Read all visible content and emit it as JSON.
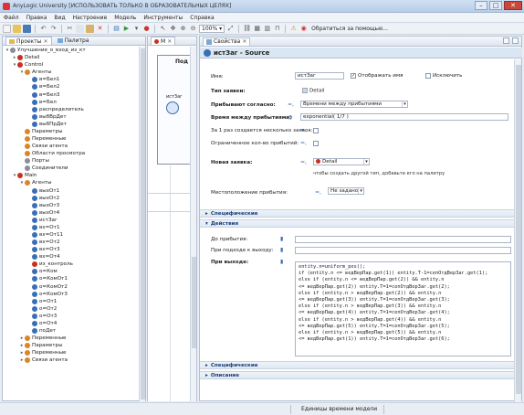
{
  "window": {
    "title": "AnyLogic University [ИСПОЛЬЗОВАТЬ ТОЛЬКО В ОБРАЗОВАТЕЛЬНЫХ ЦЕЛЯХ]",
    "min": "–",
    "max": "□",
    "close": "✕"
  },
  "menu": [
    "Файл",
    "Правка",
    "Вид",
    "Настроение",
    "Модель",
    "Инструменты",
    "Справка"
  ],
  "toolbar": {
    "zoom": "100%",
    "extra_label": "Обратиться за помощью..."
  },
  "left_panel": {
    "tabs": [
      {
        "label": "Проекты",
        "close": "✕"
      },
      {
        "label": "Палитра"
      }
    ],
    "tree": [
      {
        "indent": 0,
        "twisty": "▾",
        "icon": "gray",
        "label": "Улучшение_о_вход_из_кт"
      },
      {
        "indent": 1,
        "twisty": "▸",
        "icon": "red",
        "label": "Detail"
      },
      {
        "indent": 1,
        "twisty": "▾",
        "icon": "red",
        "label": "Control"
      },
      {
        "indent": 2,
        "twisty": "▾",
        "icon": "orange",
        "label": "Агенты"
      },
      {
        "indent": 3,
        "twisty": "",
        "icon": "blue",
        "label": "в=Бел1"
      },
      {
        "indent": 3,
        "twisty": "",
        "icon": "blue",
        "label": "в=Бел2"
      },
      {
        "indent": 3,
        "twisty": "",
        "icon": "blue",
        "label": "в=Бел3"
      },
      {
        "indent": 3,
        "twisty": "",
        "icon": "blue",
        "label": "в=Бел"
      },
      {
        "indent": 3,
        "twisty": "",
        "icon": "blue",
        "label": "распределитель"
      },
      {
        "indent": 3,
        "twisty": "",
        "icon": "blue",
        "label": "выбВрДет"
      },
      {
        "indent": 3,
        "twisty": "",
        "icon": "blue",
        "label": "выбПрДет"
      },
      {
        "indent": 2,
        "twisty": "",
        "icon": "orange",
        "label": "Параметры"
      },
      {
        "indent": 2,
        "twisty": "",
        "icon": "orange",
        "label": "Переменные"
      },
      {
        "indent": 2,
        "twisty": "",
        "icon": "orange",
        "label": "Связи агента"
      },
      {
        "indent": 2,
        "twisty": "",
        "icon": "orange",
        "label": "Области просмотра"
      },
      {
        "indent": 2,
        "twisty": "",
        "icon": "gray",
        "label": "Порты"
      },
      {
        "indent": 2,
        "twisty": "",
        "icon": "gray",
        "label": "Соединители"
      },
      {
        "indent": 1,
        "twisty": "▾",
        "icon": "red",
        "label": "Main"
      },
      {
        "indent": 2,
        "twisty": "▾",
        "icon": "orange",
        "label": "Агенты"
      },
      {
        "indent": 3,
        "twisty": "",
        "icon": "blue",
        "label": "выхОт1"
      },
      {
        "indent": 3,
        "twisty": "",
        "icon": "blue",
        "label": "выхОт2"
      },
      {
        "indent": 3,
        "twisty": "",
        "icon": "blue",
        "label": "выхОт3"
      },
      {
        "indent": 3,
        "twisty": "",
        "icon": "blue",
        "label": "выхОт4"
      },
      {
        "indent": 3,
        "twisty": "",
        "icon": "blue",
        "label": "истЗаг"
      },
      {
        "indent": 3,
        "twisty": "",
        "icon": "blue",
        "label": "вх=От1"
      },
      {
        "indent": 3,
        "twisty": "",
        "icon": "blue",
        "label": "вх=От11"
      },
      {
        "indent": 3,
        "twisty": "",
        "icon": "blue",
        "label": "вх=От2"
      },
      {
        "indent": 3,
        "twisty": "",
        "icon": "blue",
        "label": "вх=От3"
      },
      {
        "indent": 3,
        "twisty": "",
        "icon": "blue",
        "label": "вх=От4"
      },
      {
        "indent": 3,
        "twisty": "",
        "icon": "red",
        "label": "из_контроль"
      },
      {
        "indent": 3,
        "twisty": "",
        "icon": "blue",
        "label": "о=Ком"
      },
      {
        "indent": 3,
        "twisty": "",
        "icon": "blue",
        "label": "о=КомОт1"
      },
      {
        "indent": 3,
        "twisty": "",
        "icon": "blue",
        "label": "о=КомОт2"
      },
      {
        "indent": 3,
        "twisty": "",
        "icon": "blue",
        "label": "о=КомОт3"
      },
      {
        "indent": 3,
        "twisty": "",
        "icon": "blue",
        "label": "о=От1"
      },
      {
        "indent": 3,
        "twisty": "",
        "icon": "blue",
        "label": "о=От2"
      },
      {
        "indent": 3,
        "twisty": "",
        "icon": "blue",
        "label": "о=От3"
      },
      {
        "indent": 3,
        "twisty": "",
        "icon": "blue",
        "label": "о=От4"
      },
      {
        "indent": 3,
        "twisty": "",
        "icon": "blue",
        "label": "поДет"
      },
      {
        "indent": 2,
        "twisty": "▸",
        "icon": "orange",
        "label": "Переменные"
      },
      {
        "indent": 2,
        "twisty": "▸",
        "icon": "orange",
        "label": "Параметры"
      },
      {
        "indent": 2,
        "twisty": "▸",
        "icon": "orange",
        "label": "Переменные"
      },
      {
        "indent": 2,
        "twisty": "▸",
        "icon": "orange",
        "label": "Связи агента"
      }
    ]
  },
  "mid_panel": {
    "tabs": [
      {
        "label": "M",
        "close": "✕"
      }
    ],
    "frame_title": "Под",
    "block_label": "истЗаг"
  },
  "right_panel": {
    "tab_label": "Свойства",
    "tab_close": "✕",
    "header": "истЗаг - Source",
    "fields": {
      "name_label": "Имя:",
      "name_value": "истЗаг",
      "show_name_label": "Отображать имя",
      "exclude_label": "Исключить",
      "agent_type_label": "Тип заявки:",
      "agent_type_value": "Detail",
      "arrivals_label": "Прибывают согласно:",
      "arrivals_value": "Времени между прибытиями",
      "interarrival_label": "Время между прибытиями:",
      "interarrival_value": "exponential( 1/7 )",
      "multiple_label": "За 1 раз создается несколько заявок:",
      "limited_label": "Ограниченное кол-во прибытий:",
      "new_agent_label": "Новая заявка:",
      "new_agent_value": "Detail",
      "new_agent_hint": "чтобы создать другой тип, добавьте его на палитру",
      "location_label": "Местоположение прибытия:",
      "location_value": "Не задано"
    },
    "sections": {
      "specific1": "Специфические",
      "actions": "Действия",
      "specific2": "Специфические",
      "description": "Описание"
    },
    "actions": {
      "on_before_label": "До прибытия:",
      "on_exit_label": "При подходе к выходу:",
      "on_at_exit_label": "При выходе:",
      "code_lines": [
        "entity.n=uniform_pos();",
        "if (entity.n <= ведВерПар.get(1)) entity.T-1=сепОтдВерЗаг.get(1);",
        "else if (entity.n <= ведВерПар.get(2)) && entity.n",
        "<= ведВерПар.get(2)) entity.T=1=сепОтдВерЗаг.get(2);",
        "else if (entity.n > ведВерПар.get(2)) && entity.n",
        "<= ведВерПар.get(3)) entity.T=1=сепОтдВерЗаг.get(3);",
        "else if (entity.n > ведВерПар.get(3)) && entity.n",
        "<= ведВерПар.get(4)) entity.T=1=сепОтдВерЗаг.get(4);",
        "else if (entity.n > ведВерПар.get(4)) && entity.n",
        "<= ведВерПар.get(5)) entity.T=1=сепОтдВерЗаг.get(5);",
        "else if (entity.n > ведВерПар.get(5)) && entity.n",
        "<= ведВерПар.get(1)) entity.T=1=сепОтдВерЗаг.get(6);"
      ]
    }
  },
  "status": {
    "text": "Единицы времени модели"
  }
}
